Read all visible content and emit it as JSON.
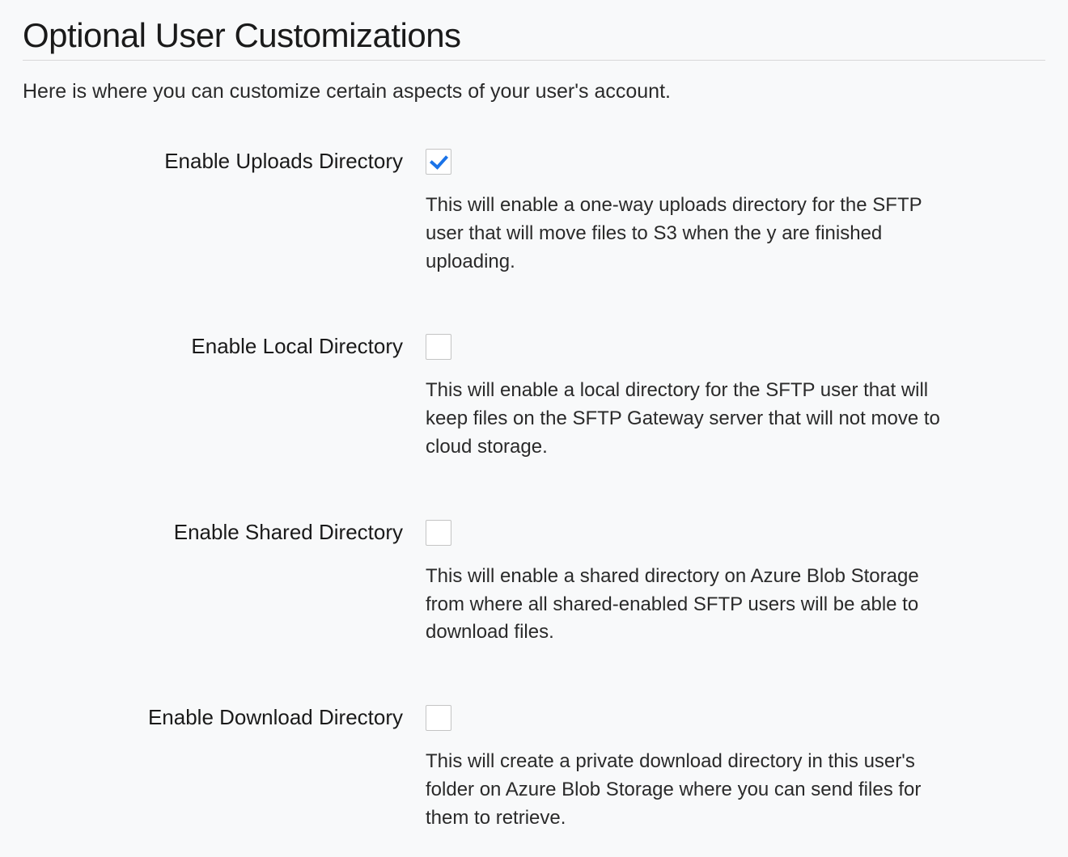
{
  "header": {
    "title": "Optional User Customizations",
    "intro": "Here is where you can customize certain aspects of your user's account."
  },
  "options": {
    "uploads": {
      "label": "Enable Uploads Directory",
      "checked": true,
      "help": "This will enable a one-way uploads directory for the SFTP user that will move files to S3 when the y are finished uploading."
    },
    "local": {
      "label": "Enable Local Directory",
      "checked": false,
      "help": "This will enable a local directory for the SFTP user that will keep files on the SFTP Gateway server that will not move to cloud storage."
    },
    "shared": {
      "label": "Enable Shared Directory",
      "checked": false,
      "help": "This will enable a shared directory on Azure Blob Storage from where all shared-enabled SFTP users will be able to download files."
    },
    "download": {
      "label": "Enable Download Directory",
      "checked": false,
      "help": "This will create a private download directory in this user's folder on Azure Blob Storage where you can send files for them to retrieve."
    }
  }
}
